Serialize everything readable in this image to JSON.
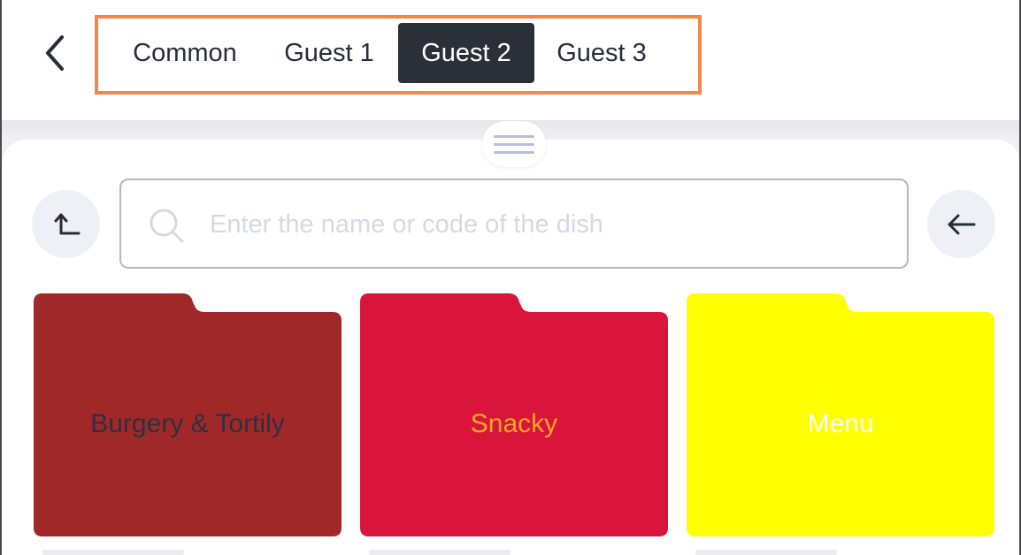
{
  "header": {
    "tabs": [
      {
        "label": "Common",
        "active": false
      },
      {
        "label": "Guest 1",
        "active": false
      },
      {
        "label": "Guest 2",
        "active": true
      },
      {
        "label": "Guest 3",
        "active": false
      }
    ],
    "highlight_color": "#f2884a"
  },
  "search": {
    "placeholder": "Enter the name or code of the dish",
    "value": ""
  },
  "buttons": {
    "up_icon": "arrow-up-left-icon",
    "back_icon": "arrow-left-icon"
  },
  "folders": [
    {
      "label": "Burgery & Tortily",
      "color": "#a02828",
      "text_color": "#2e3040"
    },
    {
      "label": "Snacky",
      "color": "#d9153c",
      "text_color": "#f5a623"
    },
    {
      "label": "Menu",
      "color": "#ffff00",
      "text_color": "#ffffff"
    }
  ]
}
